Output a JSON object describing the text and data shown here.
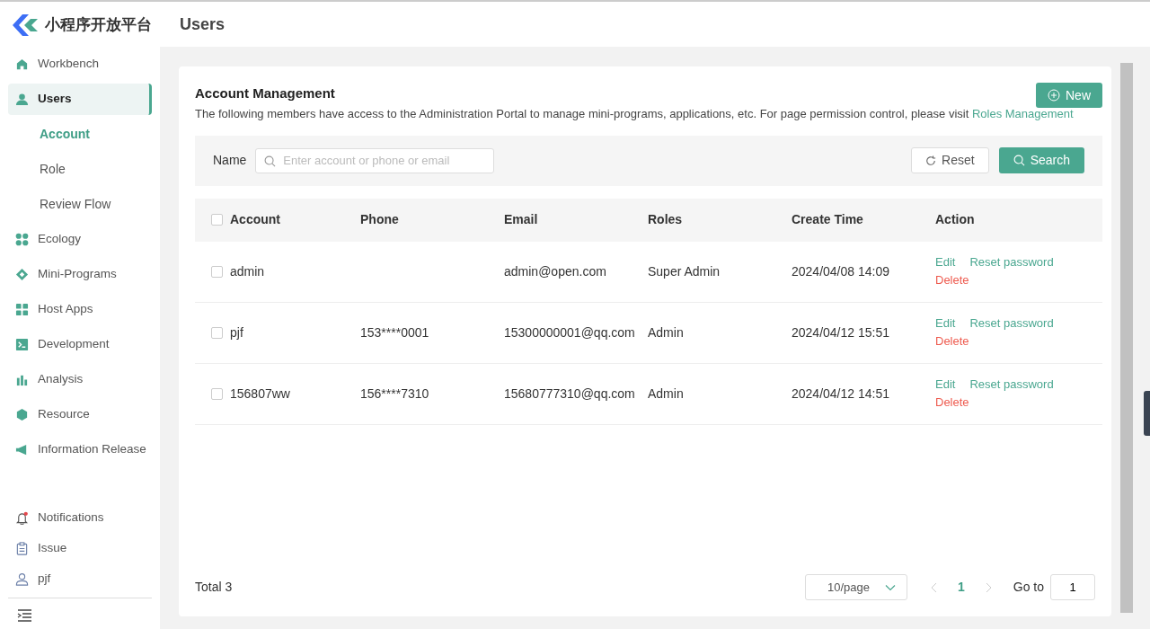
{
  "sidebar": {
    "logo": "小程序开放平台",
    "items": [
      {
        "label": "Workbench",
        "selected": false
      },
      {
        "label": "Users",
        "selected": true,
        "children": [
          {
            "label": "Account",
            "selected": true
          },
          {
            "label": "Role",
            "selected": false
          },
          {
            "label": "Review Flow",
            "selected": false
          }
        ]
      },
      {
        "label": "Ecology",
        "selected": false
      },
      {
        "label": "Mini-Programs",
        "selected": false
      },
      {
        "label": "Host Apps",
        "selected": false
      },
      {
        "label": "Development",
        "selected": false
      },
      {
        "label": "Analysis",
        "selected": false
      },
      {
        "label": "Resource",
        "selected": false
      },
      {
        "label": "Information Release",
        "selected": false
      }
    ],
    "bottom": [
      {
        "label": "Notifications"
      },
      {
        "label": "Issue"
      },
      {
        "label": "pjf"
      }
    ]
  },
  "page_title": "Users",
  "card": {
    "title": "Account Management",
    "new_button": "New",
    "description": "The following members have access to the Administration Portal to manage mini-programs, applications, etc. For page permission control, please visit",
    "description_link": "Roles Management"
  },
  "filter": {
    "label": "Name",
    "placeholder": "Enter account or phone or email",
    "reset_button": "Reset",
    "search_button": "Search"
  },
  "table": {
    "header_checked": false,
    "columns": [
      "Account",
      "Phone",
      "Email",
      "Roles",
      "Create Time",
      "Action"
    ],
    "rows": [
      {
        "checked": false,
        "cells": [
          "admin",
          "",
          "admin@open.com",
          "Super Admin",
          "2024/04/08 14:09"
        ],
        "actions": [
          "Edit",
          "Reset password",
          "Delete"
        ]
      },
      {
        "checked": false,
        "cells": [
          "pjf",
          "153****0001",
          "15300000001@qq.com",
          "Admin",
          "2024/04/12 15:51"
        ],
        "actions": [
          "Edit",
          "Reset password",
          "Delete"
        ]
      },
      {
        "checked": false,
        "cells": [
          "156807ww",
          "156****7310",
          "15680777310@qq.com",
          "Admin",
          "2024/04/12 14:51"
        ],
        "actions": [
          "Edit",
          "Reset password",
          "Delete"
        ]
      }
    ]
  },
  "pagination": {
    "total": "Total 3",
    "page_size": "10/page",
    "current_page": "1",
    "goto_label": "Go to",
    "goto_value": "1"
  }
}
